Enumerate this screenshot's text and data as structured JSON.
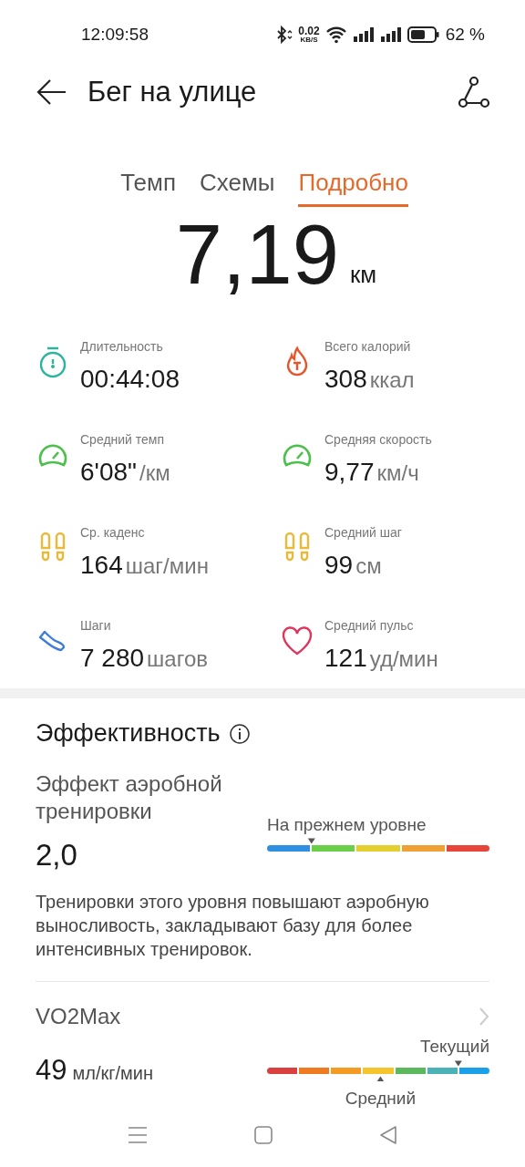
{
  "status_bar": {
    "time": "12:09:58",
    "net_speed": "0.02",
    "net_unit": "KB/S",
    "battery": "62 %"
  },
  "header": {
    "title": "Бег на улице"
  },
  "tabs": [
    {
      "label": "Темп",
      "selected": false
    },
    {
      "label": "Схемы",
      "selected": false
    },
    {
      "label": "Подробно",
      "selected": true
    }
  ],
  "distance": {
    "value": "7,19",
    "unit": "км"
  },
  "metrics": [
    {
      "kind": "stopwatch",
      "label": "Длительность",
      "value": "00:44:08"
    },
    {
      "kind": "flame",
      "label": "Всего калорий",
      "value": "308",
      "unit": "ккал"
    },
    {
      "kind": "gauge",
      "label": "Средний темп",
      "value": "6'08\"",
      "unit": "/км"
    },
    {
      "kind": "gauge",
      "label": "Средняя скорость",
      "value": "9,77",
      "unit": "км/ч"
    },
    {
      "kind": "footprints",
      "label": "Ср. каденс",
      "value": "164",
      "unit": "шаг/мин"
    },
    {
      "kind": "footprints",
      "label": "Средний шаг",
      "value": "99",
      "unit": "см"
    },
    {
      "kind": "shoe",
      "label": "Шаги",
      "value": "7 280",
      "unit": "шагов"
    },
    {
      "kind": "heart",
      "label": "Средний пульс",
      "value": "121",
      "unit": "уд/мин"
    }
  ],
  "efficiency": {
    "title": "Эффективность",
    "aerobic": {
      "title": "Эффект аэробной тренировки",
      "value": "2,0",
      "marker_label": "На прежнем уровне",
      "description": "Тренировки этого уровня повышают аэробную выносливость, закладывают базу для более интенсивных тренировок."
    },
    "vo2max": {
      "title": "VO2Max",
      "value": "49",
      "unit": "мл/кг/мин",
      "current_label": "Текущий",
      "average_label": "Средний"
    }
  }
}
